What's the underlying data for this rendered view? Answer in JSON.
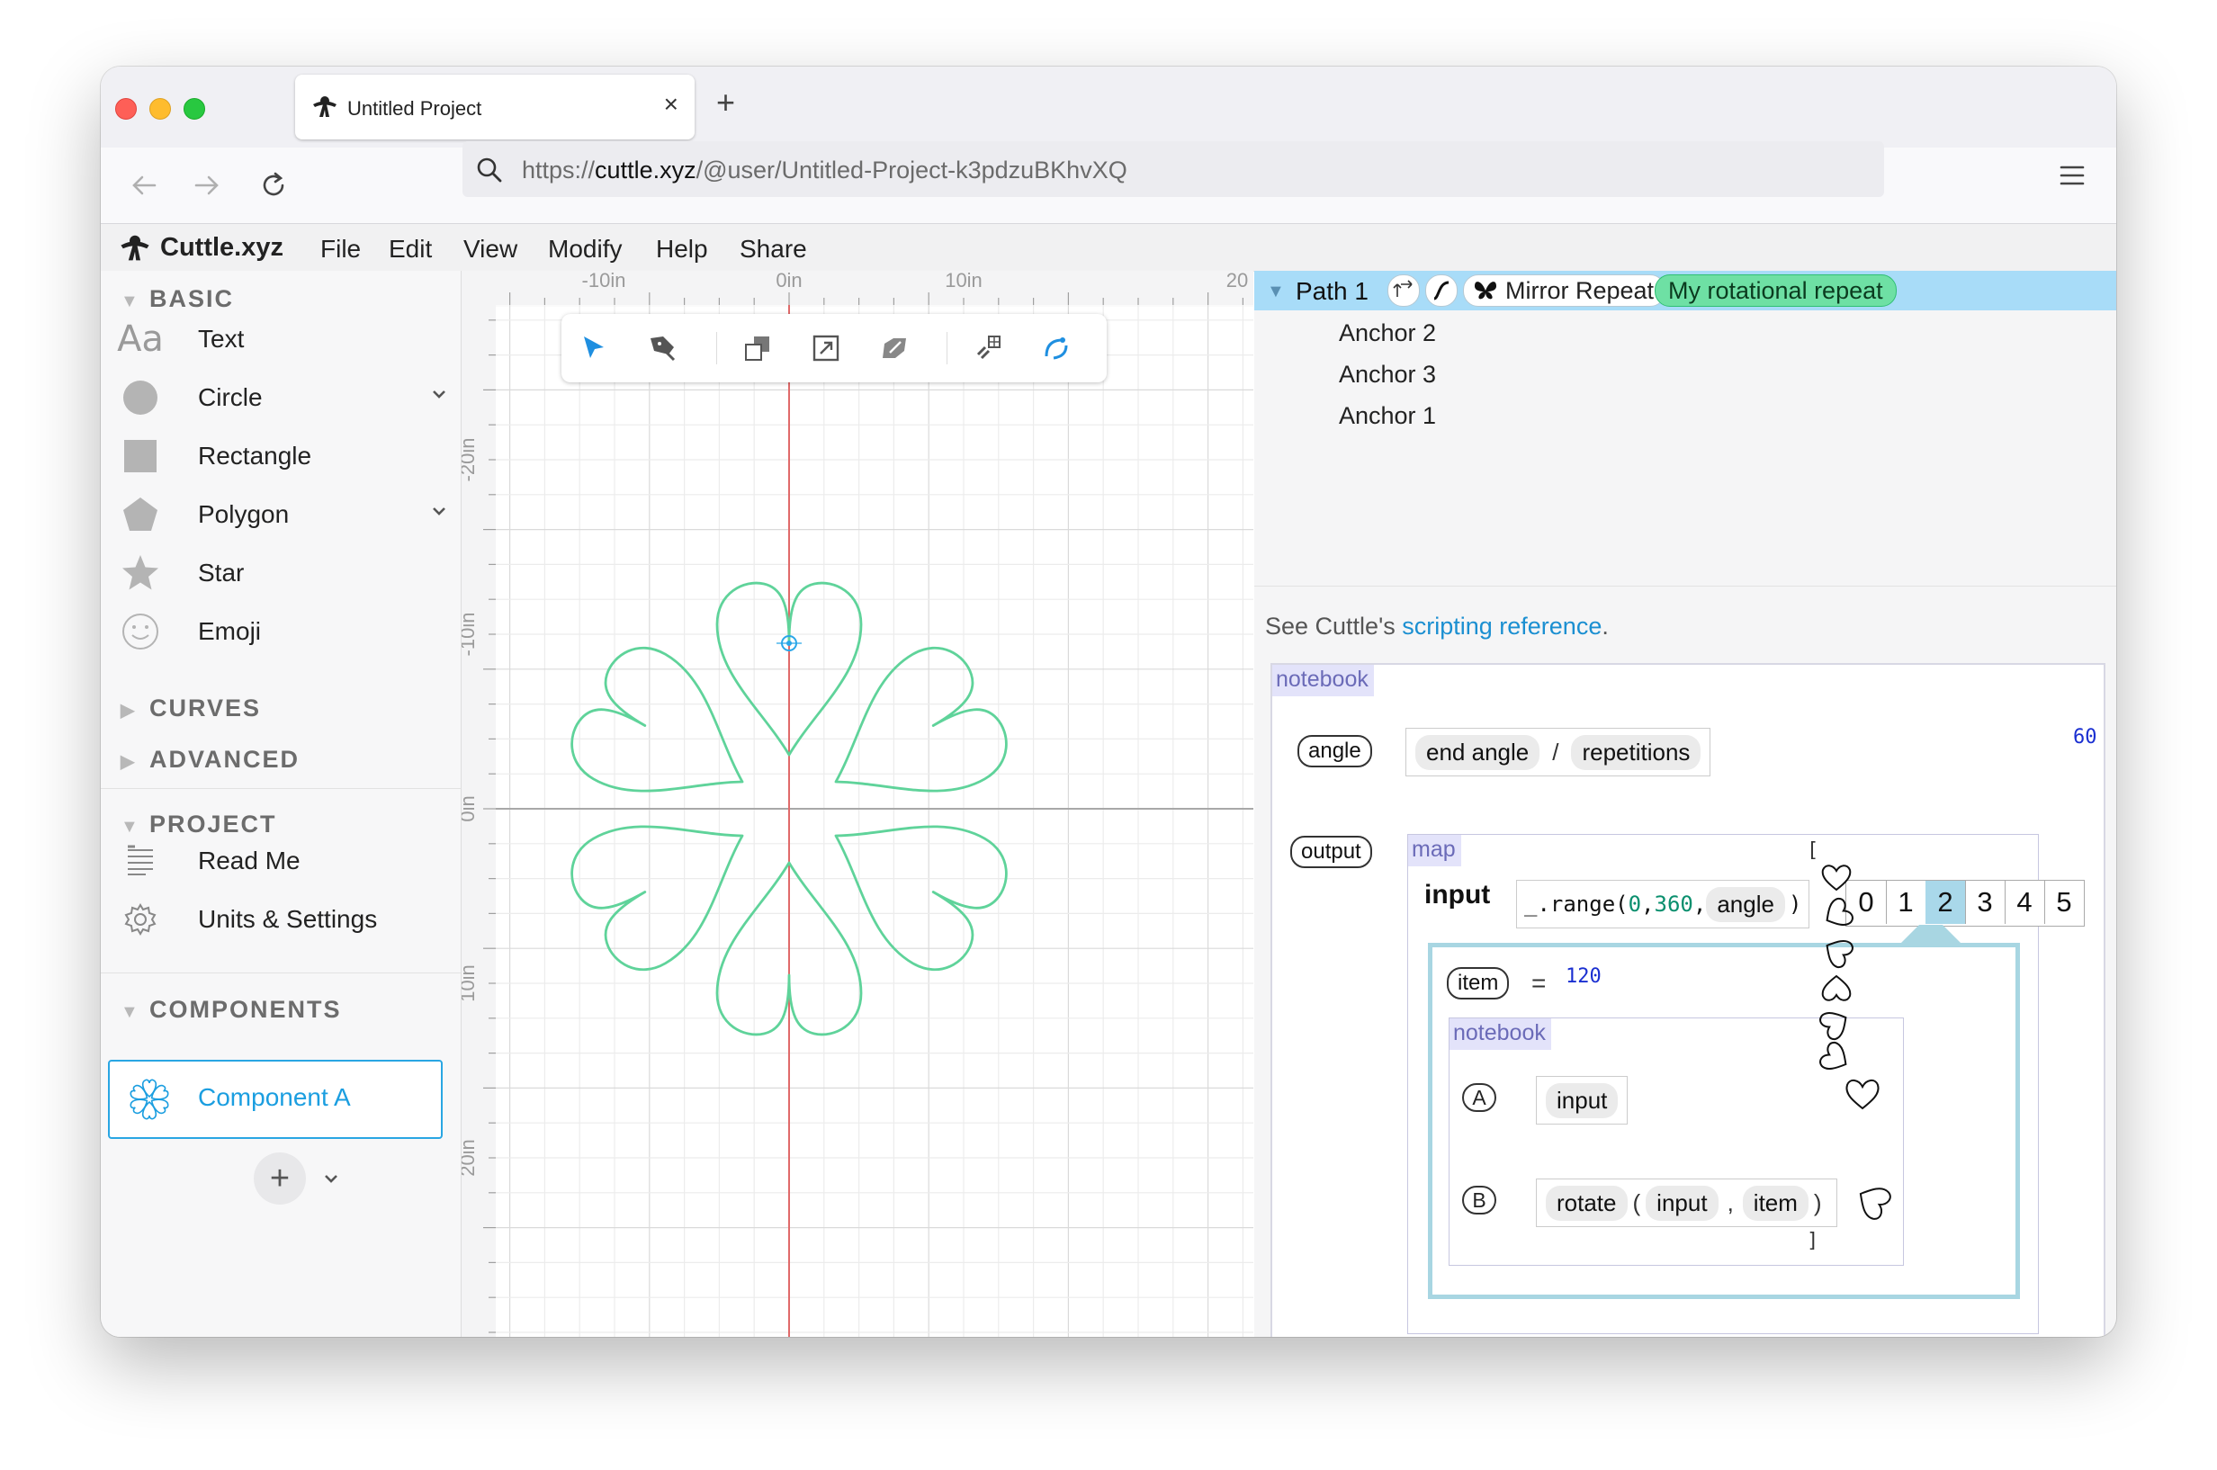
{
  "browser": {
    "tab_title": "Untitled Project",
    "tab_close": "×",
    "new_tab": "+",
    "url_prefix": "https://",
    "url_host": "cuttle.xyz",
    "url_path": "/@user/Untitled-Project-k3pdzuBKhvXQ"
  },
  "app": {
    "brand": "Cuttle.xyz",
    "menu": [
      "File",
      "Edit",
      "View",
      "Modify",
      "Help",
      "Share"
    ]
  },
  "sidebar": {
    "basic": {
      "heading": "BASIC",
      "items": [
        {
          "label": "Text",
          "icon": "text-aa-icon",
          "glyph": "Aa"
        },
        {
          "label": "Circle",
          "icon": "circle-icon",
          "has_dropdown": true
        },
        {
          "label": "Rectangle",
          "icon": "rectangle-icon"
        },
        {
          "label": "Polygon",
          "icon": "pentagon-icon",
          "has_dropdown": true
        },
        {
          "label": "Star",
          "icon": "star-icon"
        },
        {
          "label": "Emoji",
          "icon": "smiley-icon"
        }
      ]
    },
    "curves_heading": "CURVES",
    "advanced_heading": "ADVANCED",
    "project": {
      "heading": "PROJECT",
      "items": [
        {
          "label": "Read Me",
          "icon": "document-icon"
        },
        {
          "label": "Units & Settings",
          "icon": "gear-icon"
        }
      ]
    },
    "components": {
      "heading": "COMPONENTS",
      "items": [
        {
          "label": "Component A",
          "selected": true,
          "icon": "rotational-heart-icon"
        }
      ],
      "add_label": "+"
    }
  },
  "canvas": {
    "ruler_top": [
      "-10in",
      "0in",
      "10in",
      "20"
    ],
    "ruler_left": [
      "-20in",
      "-10in",
      "0in",
      "10in",
      "20in"
    ],
    "shape_color": "#5fd39a",
    "axis_y_color": "#e06a6a",
    "tools": [
      "select-arrow-icon",
      "pen-tool-icon",
      "bring-backward-icon",
      "bring-forward-icon",
      "rotate-transform-icon",
      "link-path-icon",
      "curve-edit-icon"
    ]
  },
  "panel": {
    "path_name": "Path 1",
    "modifiers": [
      {
        "label": "",
        "icon": "transform-arrows-icon"
      },
      {
        "label": "",
        "icon": "curve-s-icon"
      },
      {
        "label": "Mirror Repeat",
        "icon": "butterfly-icon"
      },
      {
        "label": "My rotational repeat",
        "highlight": true
      }
    ],
    "anchors": [
      "Anchor 2",
      "Anchor 3",
      "Anchor 1"
    ],
    "ref_prefix": "See Cuttle's ",
    "ref_link": "scripting reference",
    "ref_suffix": "."
  },
  "notebook": {
    "tag": "notebook",
    "angle": {
      "name": "angle",
      "tokens": [
        "end angle",
        "/",
        "repetitions"
      ],
      "value": "60"
    },
    "output": {
      "name": "output",
      "map_tag": "map",
      "input_label": "input",
      "range_code": "_.range(",
      "range_args": [
        "0",
        "360"
      ],
      "range_sep": ", ",
      "range_angle": "angle",
      "range_close": ")",
      "indices": [
        "0",
        "1",
        "2",
        "3",
        "4",
        "5"
      ],
      "selected_index": 2,
      "item_name": "item",
      "item_eq": "=",
      "item_value": "120",
      "inner_tag": "notebook",
      "a_label": "A",
      "a_expr": "input",
      "b_label": "B",
      "b_tokens": [
        "rotate",
        "(",
        "input",
        ",",
        "item",
        ")"
      ],
      "open_bracket": "[",
      "close_bracket": "]"
    }
  }
}
